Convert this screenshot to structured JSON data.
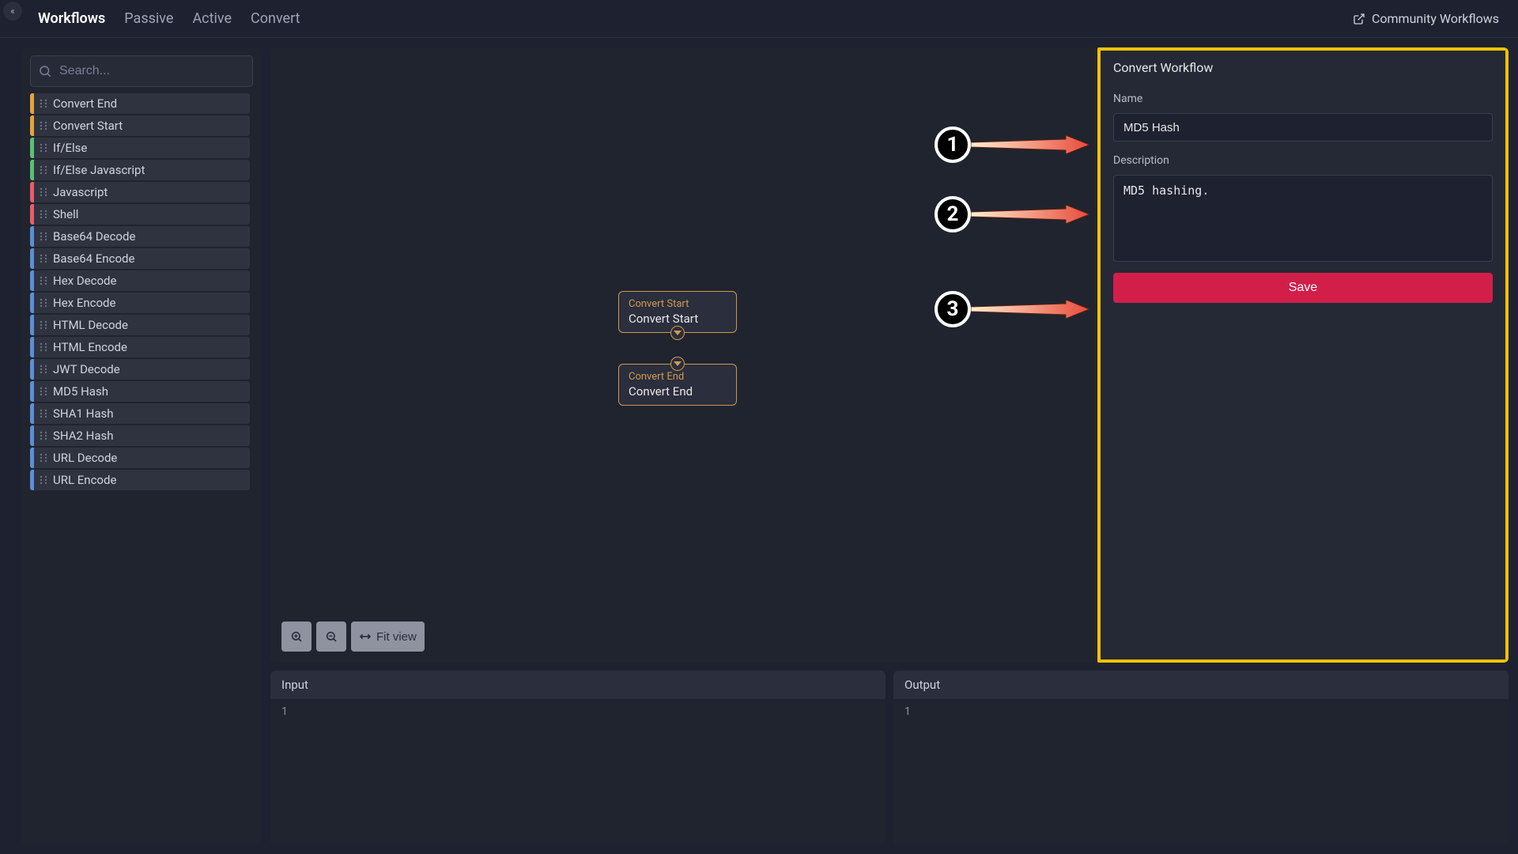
{
  "topbar": {
    "tabs": [
      {
        "label": "Workflows",
        "active": true
      },
      {
        "label": "Passive",
        "active": false
      },
      {
        "label": "Active",
        "active": false
      },
      {
        "label": "Convert",
        "active": false
      }
    ],
    "community_label": "Community Workflows"
  },
  "sidebar": {
    "search_placeholder": "Search...",
    "items": [
      {
        "label": "Convert End",
        "color": "c-orange"
      },
      {
        "label": "Convert Start",
        "color": "c-orange"
      },
      {
        "label": "If/Else",
        "color": "c-green"
      },
      {
        "label": "If/Else Javascript",
        "color": "c-green"
      },
      {
        "label": "Javascript",
        "color": "c-red"
      },
      {
        "label": "Shell",
        "color": "c-red"
      },
      {
        "label": "Base64 Decode",
        "color": "c-blue"
      },
      {
        "label": "Base64 Encode",
        "color": "c-blue"
      },
      {
        "label": "Hex Decode",
        "color": "c-blue"
      },
      {
        "label": "Hex Encode",
        "color": "c-blue"
      },
      {
        "label": "HTML Decode",
        "color": "c-blue"
      },
      {
        "label": "HTML Encode",
        "color": "c-blue"
      },
      {
        "label": "JWT Decode",
        "color": "c-blue"
      },
      {
        "label": "MD5 Hash",
        "color": "c-blue"
      },
      {
        "label": "SHA1 Hash",
        "color": "c-blue"
      },
      {
        "label": "SHA2 Hash",
        "color": "c-blue"
      },
      {
        "label": "URL Decode",
        "color": "c-blue"
      },
      {
        "label": "URL Encode",
        "color": "c-blue"
      }
    ]
  },
  "canvas": {
    "nodes": [
      {
        "type": "Convert Start",
        "title": "Convert Start"
      },
      {
        "type": "Convert End",
        "title": "Convert End"
      }
    ],
    "controls": {
      "fit_label": "Fit view"
    },
    "save_label": "Save"
  },
  "inspector": {
    "panel_title": "Convert Workflow",
    "name_label": "Name",
    "name_value": "MD5 Hash",
    "desc_label": "Description",
    "desc_value": "MD5 hashing.",
    "save_label": "Save"
  },
  "annotations": [
    "1",
    "2",
    "3"
  ],
  "io": {
    "input_label": "Input",
    "output_label": "Output",
    "input_line": "1",
    "output_line": "1"
  }
}
